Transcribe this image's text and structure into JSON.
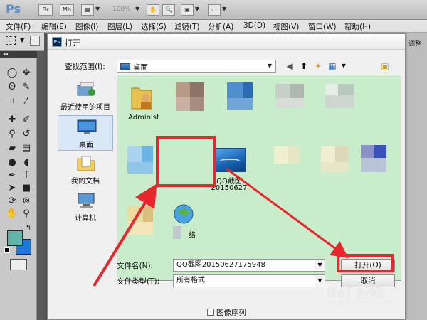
{
  "app": {
    "logo": "Ps",
    "toolbar": {
      "br": "Br",
      "mb": "Mb",
      "zoom": "100%"
    },
    "menu": [
      "文件(F)",
      "编辑(E)",
      "图像(I)",
      "图层(L)",
      "选择(S)",
      "滤镜(T)",
      "分析(A)",
      "3D(D)",
      "视图(V)",
      "窗口(W)",
      "帮助(H)"
    ],
    "right_panel_label": "调整"
  },
  "dialog": {
    "title": "打开",
    "look_in_label": "查找范围(I):",
    "look_in_value": "桌面",
    "places": [
      {
        "label": "最近使用的项目",
        "icon": "recent-items-icon"
      },
      {
        "label": "桌面",
        "icon": "desktop-icon",
        "selected": true
      },
      {
        "label": "我的文档",
        "icon": "my-documents-icon"
      },
      {
        "label": "计算机",
        "icon": "computer-icon"
      }
    ],
    "files": [
      {
        "label": "Administ",
        "icon": "folder-user-icon"
      },
      {
        "label": "",
        "icon": "blurred-file-icon"
      },
      {
        "label": "",
        "icon": "blurred-file-icon"
      },
      {
        "label": "",
        "icon": "blurred-file-icon"
      },
      {
        "label": "",
        "icon": "blurred-file-icon"
      },
      {
        "label": "",
        "icon": "blurred-file-icon"
      },
      {
        "label": "QQ截图",
        "label2": "20150627",
        "icon": "image-thumbnail-icon"
      },
      {
        "label": "",
        "icon": "blurred-file-icon"
      },
      {
        "label": "",
        "icon": "blurred-file-icon"
      },
      {
        "label": "",
        "icon": "blurred-file-icon"
      },
      {
        "label": "",
        "icon": "blurred-file-icon"
      },
      {
        "label": "络",
        "icon": "network-icon"
      }
    ],
    "filename_label": "文件名(N):",
    "filename_value": "QQ截图20150627175948",
    "filetype_label": "文件类型(T):",
    "filetype_value": "所有格式",
    "open_button": "打开(O)",
    "cancel_button": "取消",
    "image_sequence_label": "图像序列"
  },
  "watermark": {
    "text": "Bai 经验",
    "sub": "jingyan.baidu.com"
  },
  "colors": {
    "highlight": "#e8262e",
    "file_area_bg": "#c9ecca",
    "fg_swatch": "#5fb6a7",
    "bg_swatch": "#1f75d8"
  }
}
